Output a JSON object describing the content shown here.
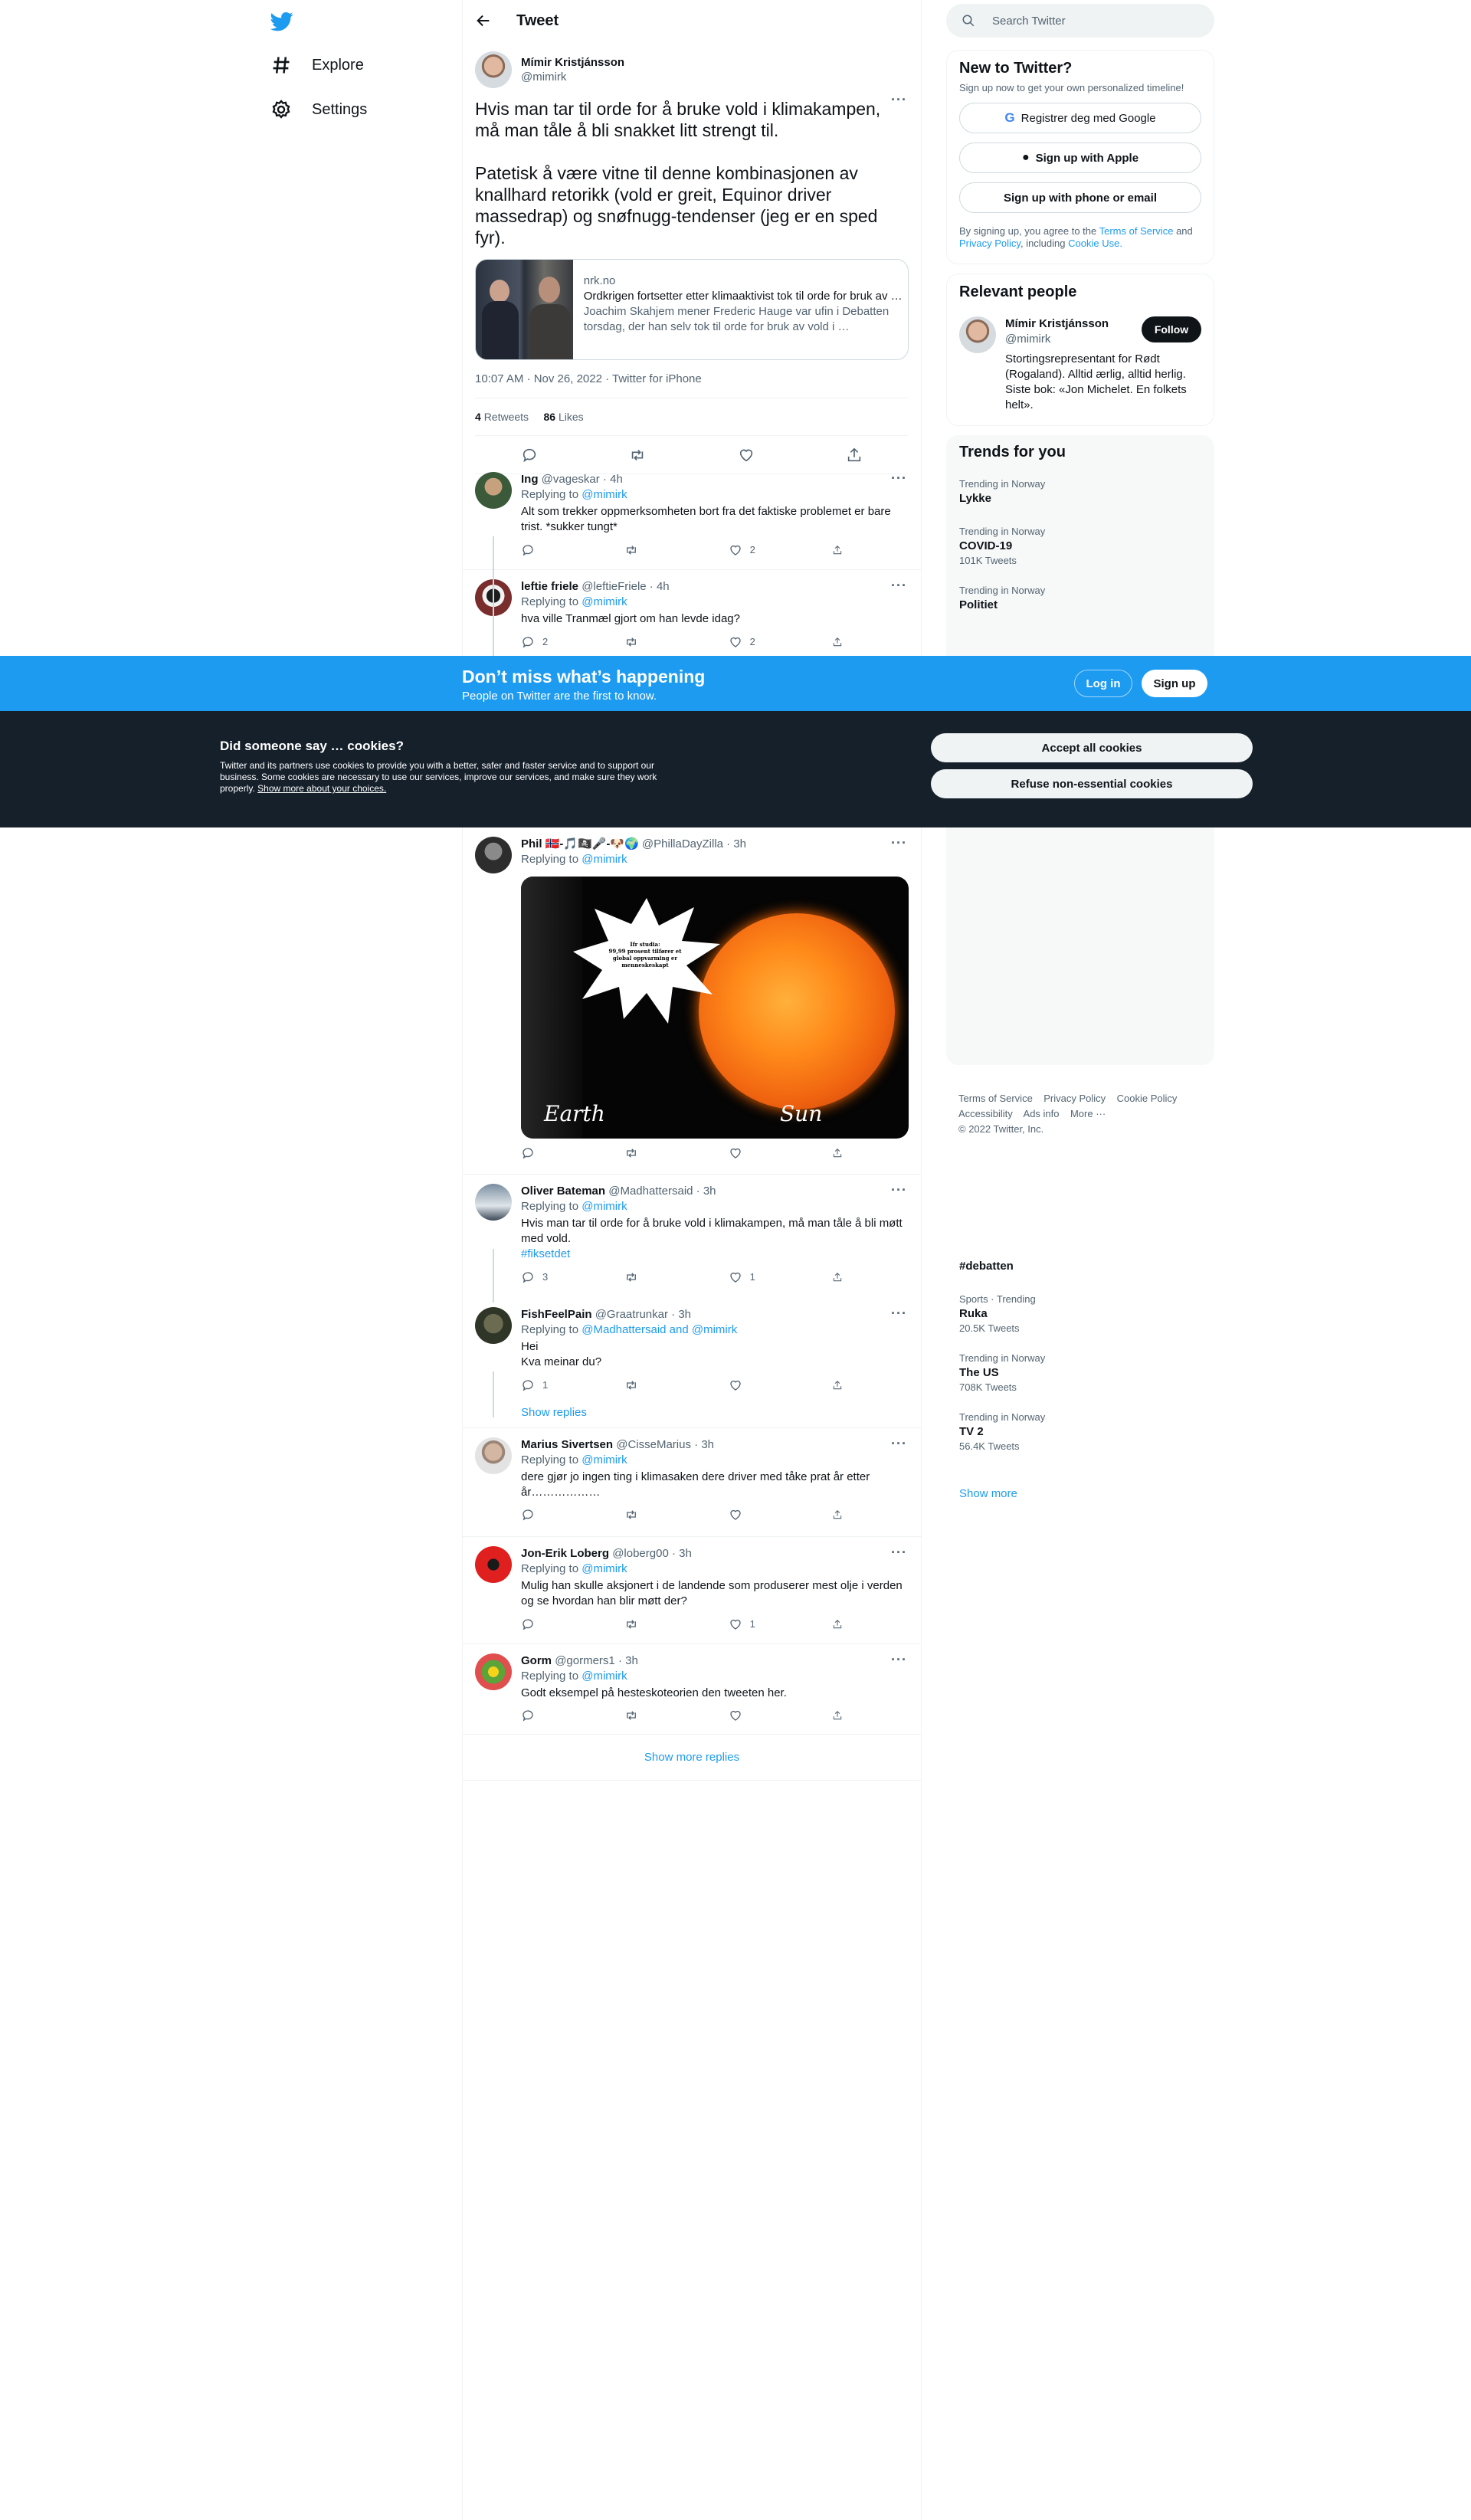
{
  "nav": {
    "explore": "Explore",
    "settings": "Settings"
  },
  "header": {
    "title": "Tweet"
  },
  "focal": {
    "name": "Mímir Kristjánsson",
    "handle": "@mimirk",
    "text": "Hvis man tar til orde for å bruke vold i klimakampen, må man tåle å bli snakket litt strengt til.\n\nPatetisk å være vitne til denne kombinasjonen av knallhard retorikk (vold er greit, Equinor driver massedrap) og snøfnugg-tendenser (jeg er en sped fyr).",
    "card": {
      "domain": "nrk.no",
      "title": "Ordkrigen fortsetter etter klimaaktivist tok til orde for bruk av vold",
      "desc": "Joachim Skahjem mener Frederic Hauge var ufin i Debatten torsdag, der han selv tok til orde for bruk av vold i …"
    },
    "meta": "10:07 AM · Nov 26, 2022 · Twitter for iPhone",
    "retweets": "4",
    "retweets_label": "Retweets",
    "likes": "86",
    "likes_label": "Likes"
  },
  "replies": [
    {
      "name": "Ing",
      "handle": "@vageskar",
      "time": "4h",
      "replying": "Replying to",
      "to": "@mimirk",
      "text": "Alt som trekker oppmerksomheten bort fra det faktiske problemet er bare trist. *sukker tungt*",
      "replies": "",
      "retweets": "",
      "likes": "2"
    },
    {
      "name": "leftie friele",
      "handle": "@leftieFriele",
      "time": "4h",
      "replying": "Replying to",
      "to": "@mimirk",
      "text": "hva ville Tranmæl gjort om han levde idag?",
      "replies": "2",
      "retweets": "",
      "likes": "2"
    },
    {
      "name": "Phil 🇳🇴-🎵🏴‍☠️🎤-🐶🌍",
      "handle": "@PhillaDayZilla",
      "time": "3h",
      "replying": "Replying to",
      "to": "@mimirk",
      "text": "",
      "replies": "",
      "retweets": "",
      "likes": ""
    },
    {
      "name": "Oliver Bateman",
      "handle": "@Madhattersaid",
      "time": "3h",
      "replying": "Replying to",
      "to": "@mimirk",
      "text": "Hvis man tar til orde for å bruke vold i klimakampen, må man tåle å bli møtt med vold.",
      "hashtag": "#fiksetdet",
      "replies": "3",
      "retweets": "",
      "likes": "1"
    },
    {
      "name": "FishFeelPain",
      "handle": "@Graatrunkar",
      "time": "3h",
      "replying": "Replying to",
      "to": "@Madhattersaid and @mimirk",
      "text": "Hei\nKva meinar du?",
      "replies": "1",
      "retweets": "",
      "likes": ""
    },
    {
      "name": "Marius Sivertsen",
      "handle": "@CisseMarius",
      "time": "3h",
      "replying": "Replying to",
      "to": "@mimirk",
      "text": "dere gjør jo ingen ting i klimasaken dere driver med tåke prat år etter år………………",
      "replies": "",
      "retweets": "",
      "likes": ""
    },
    {
      "name": "Jon-Erik Loberg",
      "handle": "@loberg00",
      "time": "3h",
      "replying": "Replying to",
      "to": "@mimirk",
      "text": "Mulig han skulle aksjonert i de landende som produserer mest olje i verden og se hvordan han blir møtt der?",
      "replies": "",
      "retweets": "",
      "likes": "1"
    },
    {
      "name": "Gorm",
      "handle": "@gormers1",
      "time": "3h",
      "replying": "Replying to",
      "to": "@mimirk",
      "text": "Godt eksempel på hesteskoteorien den tweeten her.",
      "replies": "",
      "retweets": "",
      "likes": ""
    }
  ],
  "show_replies": "Show replies",
  "show_more_replies": "Show more replies",
  "media": {
    "bubble": "Ifr studia:\n99,99 prosent tilfører et\nglobal oppvarming er\nmenneskeskapt",
    "earth": "Earth",
    "sun": "Sun"
  },
  "right": {
    "search_placeholder": "Search Twitter",
    "new_title": "New to Twitter?",
    "new_sub": "Sign up now to get your own personalized timeline!",
    "google": "Registrer deg med Google",
    "apple": "Sign up with Apple",
    "phone": "Sign up with phone or email",
    "legal_1": "By signing up, you agree to the",
    "tos": "Terms of Service",
    "and": "and",
    "privacy": "Privacy Policy",
    "including": ", including",
    "cookie_use": "Cookie Use.",
    "relevant_title": "Relevant people",
    "rel_name": "Mímir Kristjánsson",
    "rel_handle": "@mimirk",
    "follow": "Follow",
    "rel_bio": "Stortingsrepresentant for Rødt (Rogaland). Alltid ærlig, alltid herlig. Siste bok: «Jon Michelet. En folkets helt».",
    "trends_title": "Trends for you",
    "trends_top": [
      {
        "ctx": "Trending in Norway",
        "title": "Lykke",
        "count": ""
      },
      {
        "ctx": "Trending in Norway",
        "title": "COVID-19",
        "count": "101K Tweets"
      },
      {
        "ctx": "Trending in Norway",
        "title": "Politiet",
        "count": ""
      }
    ],
    "trends_bottom": [
      {
        "ctx": "",
        "title": "#debatten",
        "count": ""
      },
      {
        "ctx": "Sports · Trending",
        "title": "Ruka",
        "count": "20.5K Tweets"
      },
      {
        "ctx": "Trending in Norway",
        "title": "The US",
        "count": "708K Tweets"
      },
      {
        "ctx": "Trending in Norway",
        "title": "TV 2",
        "count": "56.4K Tweets"
      }
    ],
    "show_more": "Show more",
    "footer_1": "Terms of Service",
    "footer_2": "Privacy Policy",
    "footer_3": "Cookie Policy",
    "footer_4": "Accessibility",
    "footer_5": "Ads info",
    "footer_6": "More ···",
    "copyright": "© 2022 Twitter, Inc."
  },
  "banner": {
    "title": "Don’t miss what’s happening",
    "sub": "People on Twitter are the first to know.",
    "login": "Log in",
    "signup": "Sign up"
  },
  "cookie": {
    "title": "Did someone say … cookies?",
    "body": "Twitter and its partners use cookies to provide you with a better, safer and faster service and to support our business. Some cookies are necessary to use our services, improve our services, and make sure they work properly.",
    "link": "Show more about your choices.",
    "accept": "Accept all cookies",
    "refuse": "Refuse non-essential cookies"
  },
  "colors": {
    "accent": "#1d9bf0",
    "text": "#0f1419",
    "muted": "#536471",
    "banner": "#1d9bf0",
    "cookie_bg": "#15202b"
  }
}
